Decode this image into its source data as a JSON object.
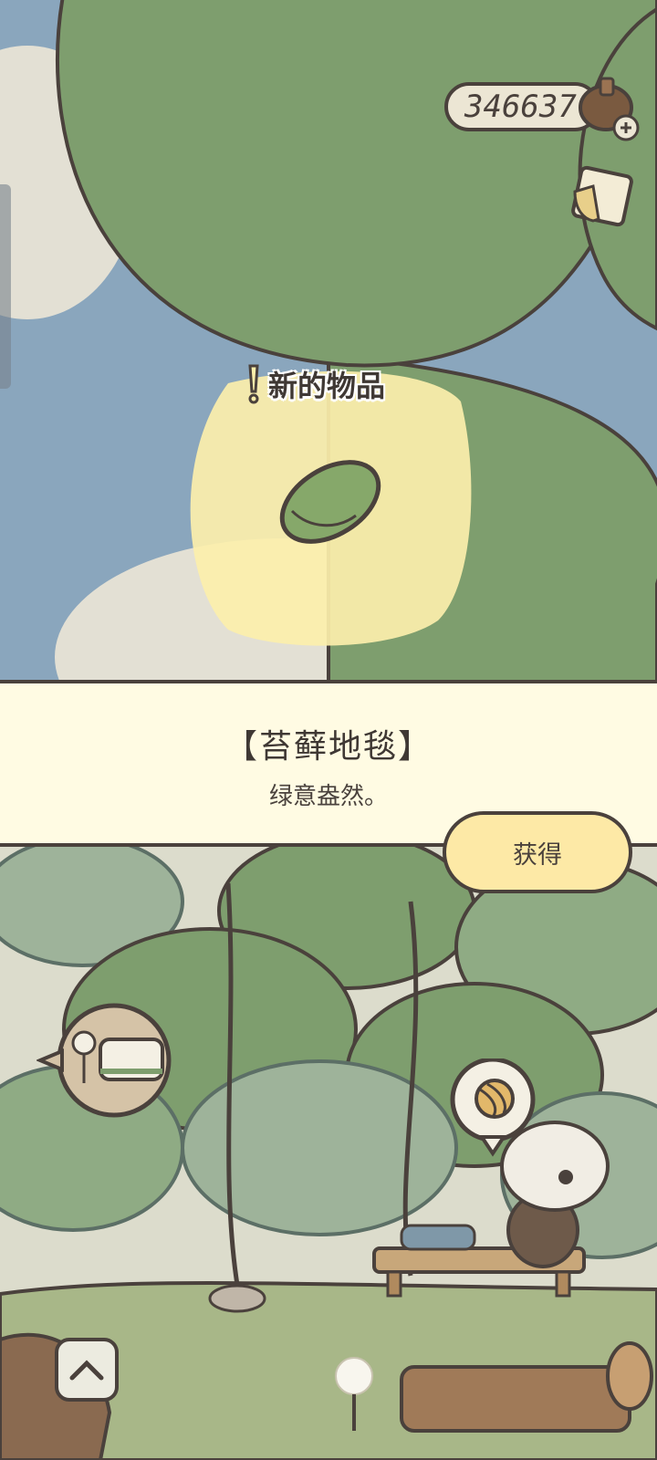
{
  "currency": {
    "amount": "346637",
    "icon": "acorn-icon",
    "add_icon": "plus-icon"
  },
  "notification": {
    "label": "新的物品",
    "icon": "exclamation-icon"
  },
  "item": {
    "name": "【苔藓地毯】",
    "description": "绿意盎然。",
    "icon": "moss-carpet-icon"
  },
  "actions": {
    "obtain_label": "获得"
  },
  "icons": {
    "inventory": "notebook-icon",
    "travel_bubble": "train-station-icon",
    "yarn_bubble": "yarn-icon",
    "collapse": "chevron-up-icon"
  },
  "colors": {
    "sky": "#8aa6bd",
    "leaf": "#7e9e6e",
    "banner_bg": "#fffbe3",
    "button_bg": "#fde9a6",
    "outline": "#4a413c",
    "highlight": "#fcefab"
  }
}
